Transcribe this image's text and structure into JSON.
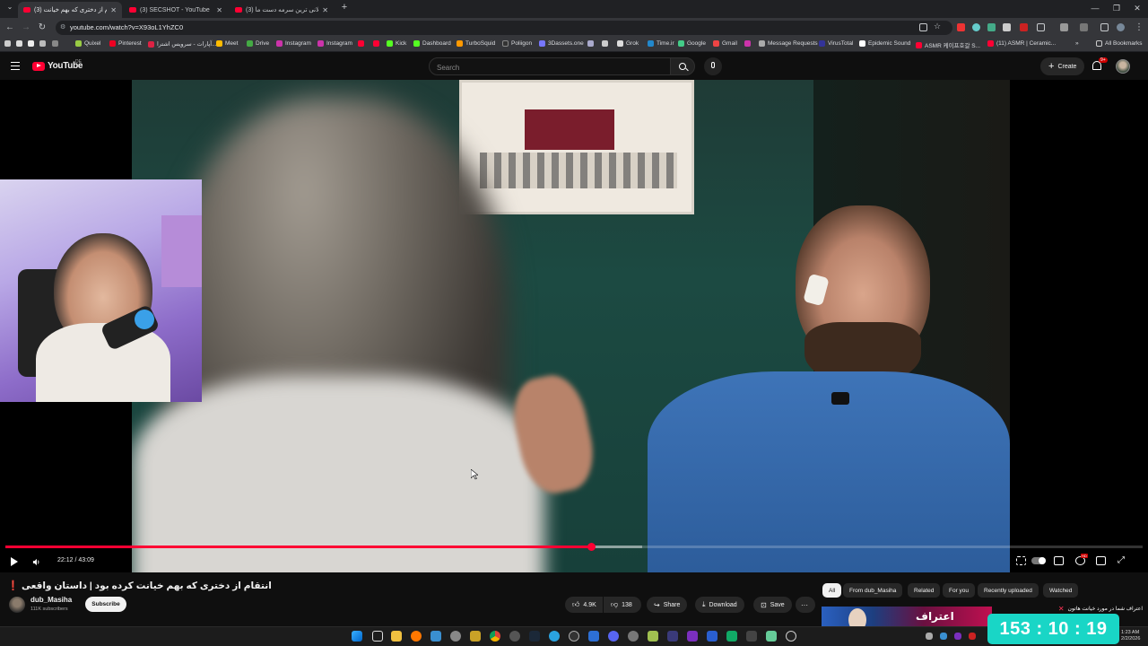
{
  "browser": {
    "tabs": [
      {
        "label": "(3) انتقام از دختری که بهم خیانت",
        "active": true
      },
      {
        "label": "(3) SECSHOT - YouTube",
        "active": false
      },
      {
        "label": "(3) طولانی ترین سرمه دست ما",
        "active": false
      }
    ],
    "new_tab": "+",
    "url": "youtube.com/watch?v=X93oL1YhZC0",
    "bookmarks": [
      "Quixel",
      "Pinterest",
      "آپارات - سرویس اشترا...",
      "Meet",
      "Drive",
      "Instagram",
      "Instagram",
      "Kick",
      "Dashboard",
      "TurboSquid",
      "Poliigon",
      "3Dassets.one",
      "Grok",
      "Time.ir",
      "Google",
      "Gmail",
      "Message Requests",
      "VirusTotal",
      "Epidemic Sound",
      "ASMR 케이프호갈 S...",
      "(11) ASMR | Ceramic...",
      "All Bookmarks"
    ]
  },
  "youtube": {
    "logo_text": "YouTube",
    "logo_country": "DE",
    "search_placeholder": "Search",
    "create_label": "Create",
    "notif_count": "9+"
  },
  "player": {
    "time_current": "22:12",
    "time_total": "43:09",
    "time_display": "22:12 / 43:09",
    "played_fraction": 0.515,
    "buffered_fraction": 0.56
  },
  "video": {
    "title": "انتقام از دختری که بهم خیانت کرده بود | داستان واقعی ❗",
    "channel": "dub_Masiha",
    "subscribers": "111K subscribers",
    "subscribe_label": "Subscribe",
    "likes": "4.9K",
    "dislikes": "138",
    "share_label": "Share",
    "download_label": "Download",
    "save_label": "Save"
  },
  "filters": [
    "All",
    "From dub_Masiha",
    "Related",
    "For you",
    "Recently uploaded",
    "Watched"
  ],
  "recommendation": {
    "thumb_text": "اعتراف",
    "notification_text": "اعتراف شما در مورد خیانت هاتون"
  },
  "overlay_timer": "153 : 10 : 19",
  "taskbar": {
    "time": "1:23 AM",
    "date": "2/2/2026"
  },
  "colors": {
    "yt_red": "#ff0033",
    "timer_bg": "#19d6c6",
    "bg": "#0f0f0f"
  }
}
